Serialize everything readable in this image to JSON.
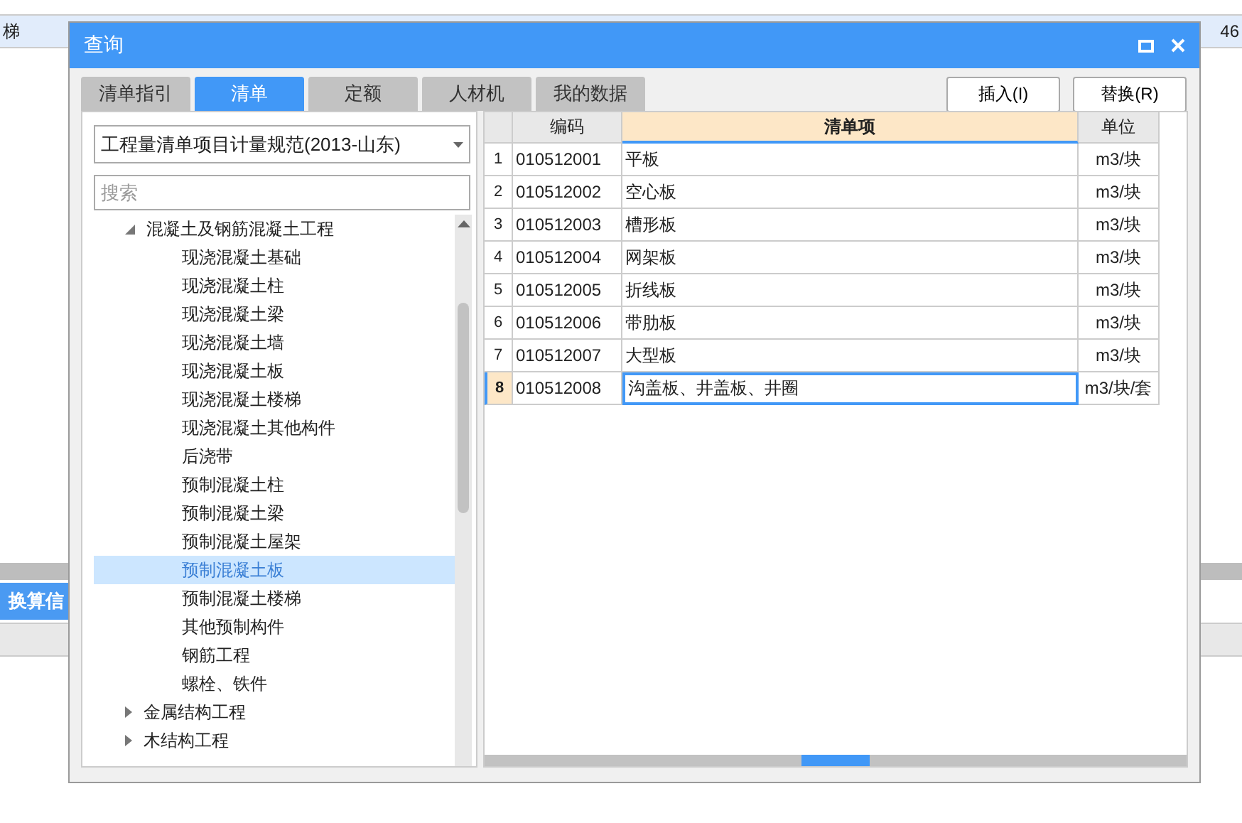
{
  "background": {
    "row_label": "梯",
    "row_value": "46",
    "panel_tab": "换算信"
  },
  "dialog": {
    "title": "查询",
    "tabs": [
      {
        "label": "清单指引",
        "selected": false
      },
      {
        "label": "清单",
        "selected": true
      },
      {
        "label": "定额",
        "selected": false
      },
      {
        "label": "人材机",
        "selected": false
      },
      {
        "label": "我的数据",
        "selected": false
      }
    ],
    "buttons": [
      "插入(I)",
      "替换(R)"
    ],
    "norm_select": {
      "value": "工程量清单项目计量规范(2013-山东)"
    },
    "search": {
      "placeholder": "搜索"
    },
    "tree": [
      {
        "label": "混凝土及钢筋混凝土工程",
        "expanded": true,
        "selected": false,
        "children": [
          {
            "label": "现浇混凝土基础",
            "selected": false
          },
          {
            "label": "现浇混凝土柱",
            "selected": false
          },
          {
            "label": "现浇混凝土梁",
            "selected": false
          },
          {
            "label": "现浇混凝土墙",
            "selected": false
          },
          {
            "label": "现浇混凝土板",
            "selected": false
          },
          {
            "label": "现浇混凝土楼梯",
            "selected": false
          },
          {
            "label": "现浇混凝土其他构件",
            "selected": false
          },
          {
            "label": "后浇带",
            "selected": false
          },
          {
            "label": "预制混凝土柱",
            "selected": false
          },
          {
            "label": "预制混凝土梁",
            "selected": false
          },
          {
            "label": "预制混凝土屋架",
            "selected": false
          },
          {
            "label": "预制混凝土板",
            "selected": true
          },
          {
            "label": "预制混凝土楼梯",
            "selected": false
          },
          {
            "label": "其他预制构件",
            "selected": false
          },
          {
            "label": "钢筋工程",
            "selected": false
          },
          {
            "label": "螺栓、铁件",
            "selected": false
          }
        ]
      },
      {
        "label": "金属结构工程",
        "expanded": false,
        "selected": false
      },
      {
        "label": "木结构工程",
        "expanded": false,
        "selected": false
      }
    ],
    "table": {
      "columns": [
        {
          "label": "编码",
          "active": false
        },
        {
          "label": "清单项",
          "active": true
        },
        {
          "label": "单位",
          "active": false
        }
      ],
      "rows": [
        {
          "index": "1",
          "code": "010512001",
          "name": "平板",
          "unit": "m3/块",
          "selected": false
        },
        {
          "index": "2",
          "code": "010512002",
          "name": "空心板",
          "unit": "m3/块",
          "selected": false
        },
        {
          "index": "3",
          "code": "010512003",
          "name": "槽形板",
          "unit": "m3/块",
          "selected": false
        },
        {
          "index": "4",
          "code": "010512004",
          "name": "网架板",
          "unit": "m3/块",
          "selected": false
        },
        {
          "index": "5",
          "code": "010512005",
          "name": "折线板",
          "unit": "m3/块",
          "selected": false
        },
        {
          "index": "6",
          "code": "010512006",
          "name": "带肋板",
          "unit": "m3/块",
          "selected": false
        },
        {
          "index": "7",
          "code": "010512007",
          "name": "大型板",
          "unit": "m3/块",
          "selected": false
        },
        {
          "index": "8",
          "code": "010512008",
          "name": "沟盖板、井盖板、井圈",
          "unit": "m3/块/套",
          "selected": true
        }
      ]
    }
  }
}
